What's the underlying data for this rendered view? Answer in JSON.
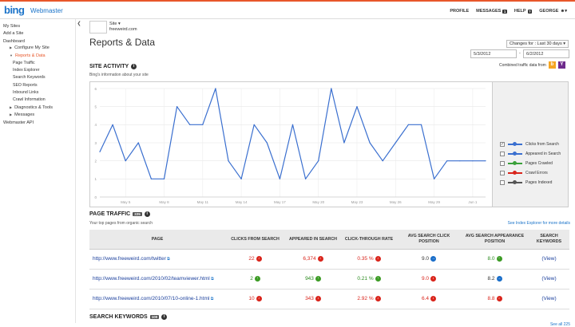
{
  "header": {
    "logo": "bing",
    "brand": "Webmaster",
    "nav": [
      {
        "label": "PROFILE",
        "badge": ""
      },
      {
        "label": "MESSAGES",
        "badge": "1"
      },
      {
        "label": "HELP",
        "badge": "?"
      },
      {
        "label": "GEORGE",
        "badge": ""
      }
    ]
  },
  "sidebar": {
    "items": [
      {
        "label": "My Sites",
        "level": 0
      },
      {
        "label": "Add a Site",
        "level": 0
      },
      {
        "label": "Dashboard",
        "level": 0
      },
      {
        "label": "Configure My Site",
        "level": 1,
        "arrow": "right"
      },
      {
        "label": "Reports & Data",
        "level": 1,
        "arrow": "down",
        "active": true
      },
      {
        "label": "Page Traffic",
        "level": 2
      },
      {
        "label": "Index Explorer",
        "level": 2
      },
      {
        "label": "Search Keywords",
        "level": 2
      },
      {
        "label": "SEO Reports",
        "level": 2
      },
      {
        "label": "Inbound Links",
        "level": 2
      },
      {
        "label": "Crawl Information",
        "level": 2
      },
      {
        "label": "Diagnostics & Tools",
        "level": 1,
        "arrow": "right"
      },
      {
        "label": "Messages",
        "level": 1,
        "arrow": "right"
      },
      {
        "label": "Webmaster API",
        "level": 0
      }
    ]
  },
  "site": {
    "selector_label": "Site ▾",
    "name": "freeweird.com"
  },
  "page_title": "Reports & Data",
  "changes_for": "Changes for : Last 30 days",
  "date_from": "5/3/2012",
  "date_to": "6/2/2012",
  "combined_traffic": "Combined traffic data from",
  "site_activity": {
    "title": "SITE ACTIVITY",
    "subtitle": "Bing's information about your site"
  },
  "chart_data": {
    "type": "line",
    "x": [
      "May 3",
      "May 4",
      "May 5",
      "May 6",
      "May 7",
      "May 8",
      "May 9",
      "May 10",
      "May 11",
      "May 12",
      "May 13",
      "May 14",
      "May 15",
      "May 16",
      "May 17",
      "May 18",
      "May 19",
      "May 20",
      "May 21",
      "May 22",
      "May 23",
      "May 24",
      "May 25",
      "May 26",
      "May 27",
      "May 28",
      "May 29",
      "May 30",
      "May 31",
      "Jun 1",
      "Jun 2"
    ],
    "xticks": [
      "May 5",
      "May 8",
      "May 11",
      "May 14",
      "May 17",
      "May 20",
      "May 23",
      "May 26",
      "May 29",
      "Jun 1"
    ],
    "yticks": [
      0,
      1,
      2,
      3,
      4,
      5,
      6
    ],
    "ylim": [
      0,
      6
    ],
    "series": [
      {
        "name": "Clicks from Search",
        "values": [
          2.5,
          4,
          2,
          3,
          1,
          1,
          5,
          4,
          4,
          6,
          2,
          1,
          4,
          3,
          1,
          4,
          1,
          2,
          6,
          3,
          5,
          3,
          2,
          3,
          4,
          4,
          1,
          2,
          2,
          2,
          2
        ]
      }
    ],
    "grid": true
  },
  "legend": [
    {
      "label": "Clicks from Search",
      "color": "#3a6fcf",
      "checked": true
    },
    {
      "label": "Appeared in Search",
      "color": "#3a6fcf",
      "checked": false
    },
    {
      "label": "Pages Crawled",
      "color": "#3aa13a",
      "checked": false
    },
    {
      "label": "Crawl Errors",
      "color": "#d9241b",
      "checked": false
    },
    {
      "label": "Pages Indexed",
      "color": "#555555",
      "checked": false
    }
  ],
  "page_traffic": {
    "title": "PAGE TRAFFIC",
    "count": "225",
    "subtitle": "Your top pages from organic search",
    "see_index": "See Index Explorer for more details",
    "columns": [
      "PAGE",
      "CLICKS FROM SEARCH",
      "APPEARED IN SEARCH",
      "CLICK-THROUGH RATE",
      "AVG SEARCH CLICK POSITION",
      "AVG SEARCH APPEARANCE POSITION",
      "SEARCH KEYWORDS"
    ],
    "rows": [
      {
        "page": "http://www.freeweird.com/twitter",
        "clicks": "22",
        "clicks_dir": "dn",
        "appeared": "6,374",
        "appeared_dir": "dn",
        "ctr": "0.35 %",
        "ctr_dir": "dn",
        "click_pos": "9.0",
        "click_pos_dir": "rt",
        "app_pos": "8.0",
        "app_pos_dir": "up",
        "keywords": "(View)"
      },
      {
        "page": "http://www.freeweird.com/2010/02/teamviewer.html",
        "clicks": "2",
        "clicks_dir": "up",
        "appeared": "943",
        "appeared_dir": "up",
        "ctr": "0.21 %",
        "ctr_dir": "up",
        "click_pos": "9.0",
        "click_pos_dir": "dn",
        "app_pos": "8.2",
        "app_pos_dir": "rt",
        "keywords": "(View)"
      },
      {
        "page": "http://www.freeweird.com/2010/07/10-online-1.html",
        "clicks": "10",
        "clicks_dir": "dn",
        "appeared": "343",
        "appeared_dir": "dn",
        "ctr": "2.92 %",
        "ctr_dir": "dn",
        "click_pos": "6.4",
        "click_pos_dir": "dn",
        "app_pos": "8.8",
        "app_pos_dir": "dn",
        "keywords": "(View)"
      }
    ],
    "see_all": "See all 225"
  },
  "search_keywords": {
    "title": "SEARCH KEYWORDS",
    "count": "100"
  }
}
